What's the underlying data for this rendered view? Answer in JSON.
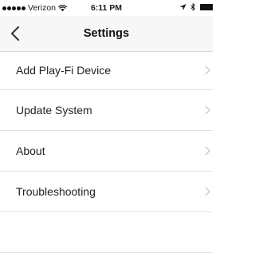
{
  "status_bar": {
    "carrier": "Verizon",
    "time": "6:11 PM",
    "icons": [
      "signal-dots-icon",
      "wifi-icon",
      "location-arrow-icon",
      "bluetooth-icon",
      "battery-icon"
    ]
  },
  "nav": {
    "back_icon": "chevron-left-icon",
    "title": "Settings"
  },
  "menu": {
    "items": [
      {
        "label": "Add Play-Fi Device"
      },
      {
        "label": "Update System"
      },
      {
        "label": "About"
      },
      {
        "label": "Troubleshooting"
      },
      {
        "label": ""
      }
    ],
    "chevron_color": "#c7c7cc"
  },
  "colors": {
    "nav_bg": "#f7f7f7",
    "separator": "#e1e1e1",
    "text": "#222222"
  }
}
